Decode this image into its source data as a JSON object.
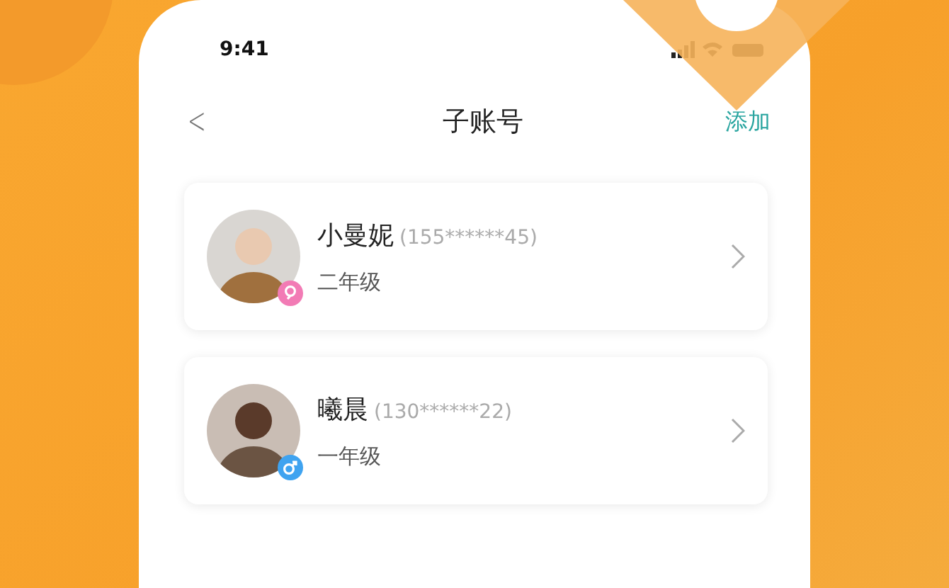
{
  "status_bar": {
    "time": "9:41"
  },
  "nav": {
    "back": "<",
    "title": "子账号",
    "action": "添加"
  },
  "accounts": [
    {
      "name": "小曼妮",
      "phone": "(155******45)",
      "grade": "二年级",
      "kind": "female"
    },
    {
      "name": "曦晨",
      "phone": "(130******22)",
      "grade": "一年级",
      "kind": "male"
    }
  ]
}
